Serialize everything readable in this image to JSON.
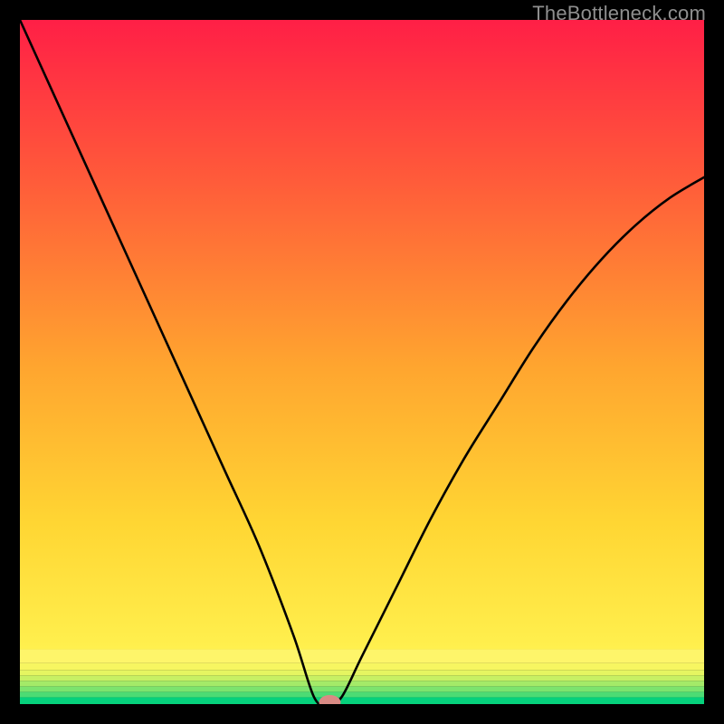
{
  "watermark": "TheBottleneck.com",
  "chart_data": {
    "type": "line",
    "title": "",
    "xlabel": "",
    "ylabel": "",
    "xlim": [
      0,
      100
    ],
    "ylim": [
      0,
      100
    ],
    "x": [
      0,
      5,
      10,
      15,
      20,
      25,
      30,
      35,
      40,
      43,
      45,
      47,
      50,
      55,
      60,
      65,
      70,
      75,
      80,
      85,
      90,
      95,
      100
    ],
    "y": [
      100,
      89,
      78,
      67,
      56,
      45,
      34,
      23,
      10,
      1,
      0,
      1,
      7,
      17,
      27,
      36,
      44,
      52,
      59,
      65,
      70,
      74,
      77
    ],
    "marker": {
      "x": 45.3,
      "y": 0.0
    },
    "gradient_bands": [
      {
        "y0": 0.0,
        "y1": 1.0,
        "color": "#06d17c"
      },
      {
        "y0": 1.0,
        "y1": 1.8,
        "color": "#4cdb74"
      },
      {
        "y0": 1.8,
        "y1": 2.6,
        "color": "#7ce36e"
      },
      {
        "y0": 2.6,
        "y1": 3.4,
        "color": "#a4ea68"
      },
      {
        "y0": 3.4,
        "y1": 4.2,
        "color": "#c7f064"
      },
      {
        "y0": 4.2,
        "y1": 5.0,
        "color": "#e5f561"
      },
      {
        "y0": 5.0,
        "y1": 6.0,
        "color": "#f7f661"
      },
      {
        "y0": 6.0,
        "y1": 8.0,
        "color": "#fef56a"
      },
      {
        "y0": 8.0,
        "y1": 100,
        "color": "gradient"
      }
    ]
  }
}
